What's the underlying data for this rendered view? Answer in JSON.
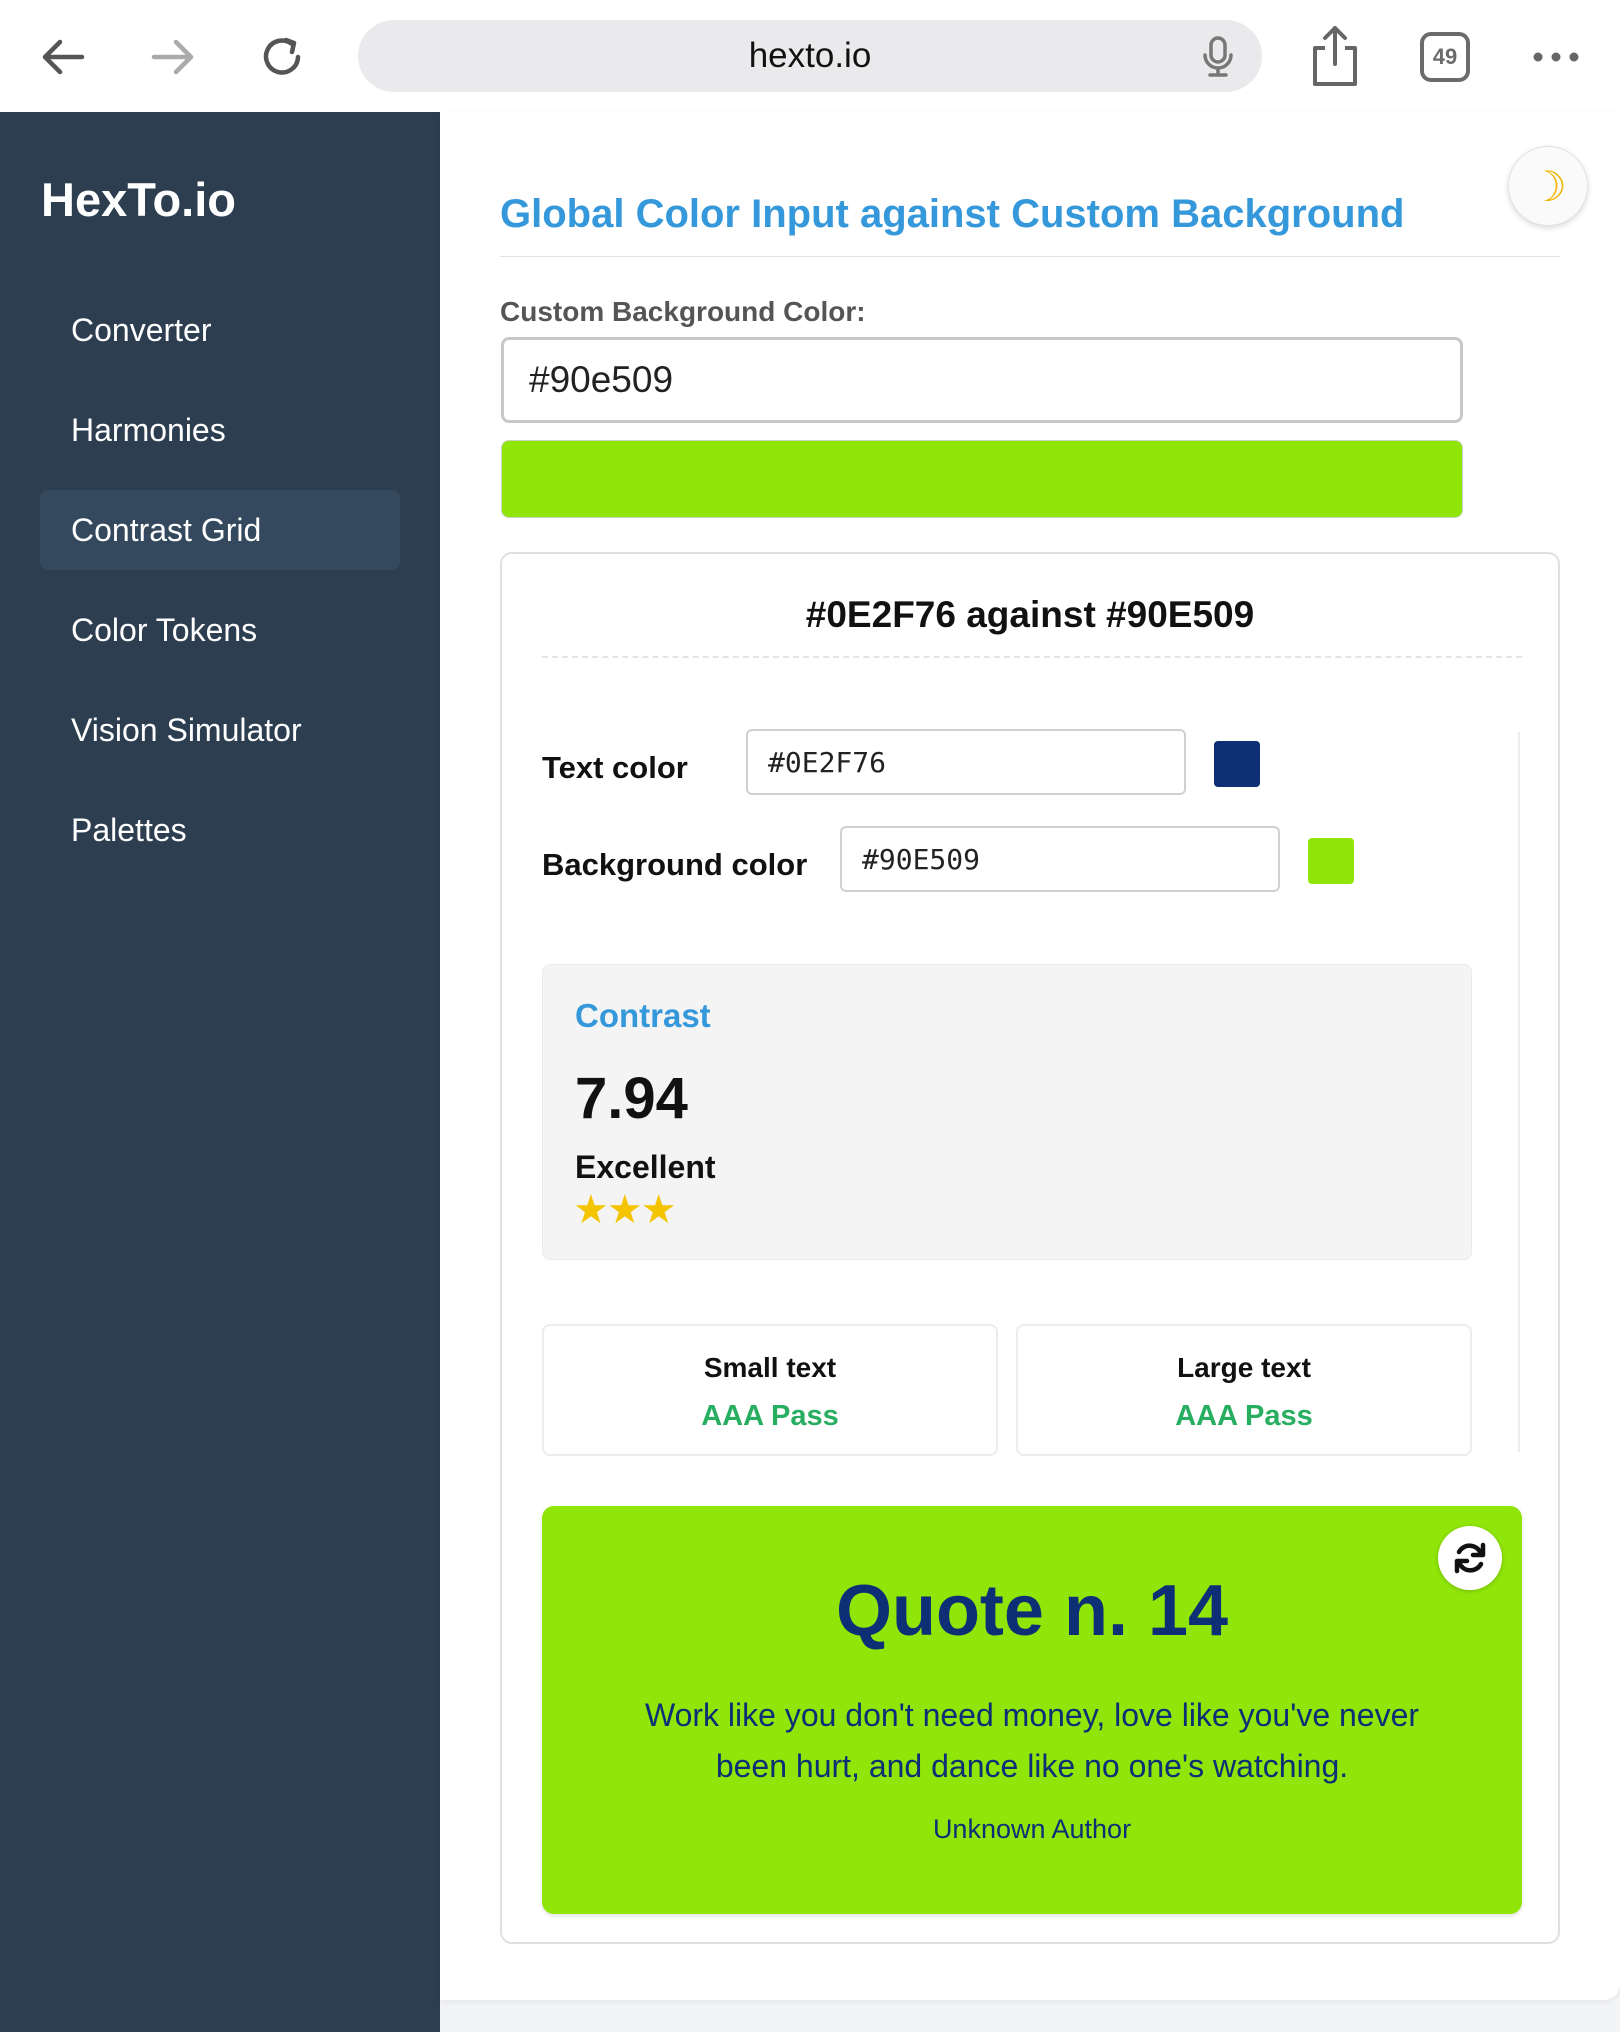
{
  "browser": {
    "url": "hexto.io",
    "tab_count": "49"
  },
  "sidebar": {
    "brand": "HexTo.io",
    "items": [
      {
        "label": "Converter"
      },
      {
        "label": "Harmonies"
      },
      {
        "label": "Contrast Grid"
      },
      {
        "label": "Color Tokens"
      },
      {
        "label": "Vision Simulator"
      },
      {
        "label": "Palettes"
      }
    ],
    "active_item": "Contrast Grid"
  },
  "main": {
    "theme_toggle_icon": "moon-icon",
    "title": "Global Color Input against Custom Background",
    "bg_label": "Custom Background Color:",
    "bg_value": "#90e509"
  },
  "card": {
    "title": "#0E2F76 against #90E509",
    "text_color_label": "Text color",
    "text_color_value": "#0E2F76",
    "bg_color_label": "Background color",
    "bg_color_value": "#90E509",
    "contrast_heading": "Contrast",
    "contrast_ratio": "7.94",
    "rating": "Excellent",
    "stars": 3,
    "small_text_label": "Small text",
    "small_text_result": "AAA Pass",
    "large_text_label": "Large text",
    "large_text_result": "AAA Pass"
  },
  "quote": {
    "title": "Quote n. 14",
    "text": "Work like you don't need money, love like you've never been hurt, and dance like no one's watching.",
    "author": "Unknown Author"
  },
  "colors": {
    "sidebar_bg": "#2c3e50",
    "sidebar_active": "#34495e",
    "accent": "#3498db",
    "pass": "#27ae60",
    "text_color": "#0E2F76",
    "background_color": "#90E509"
  }
}
